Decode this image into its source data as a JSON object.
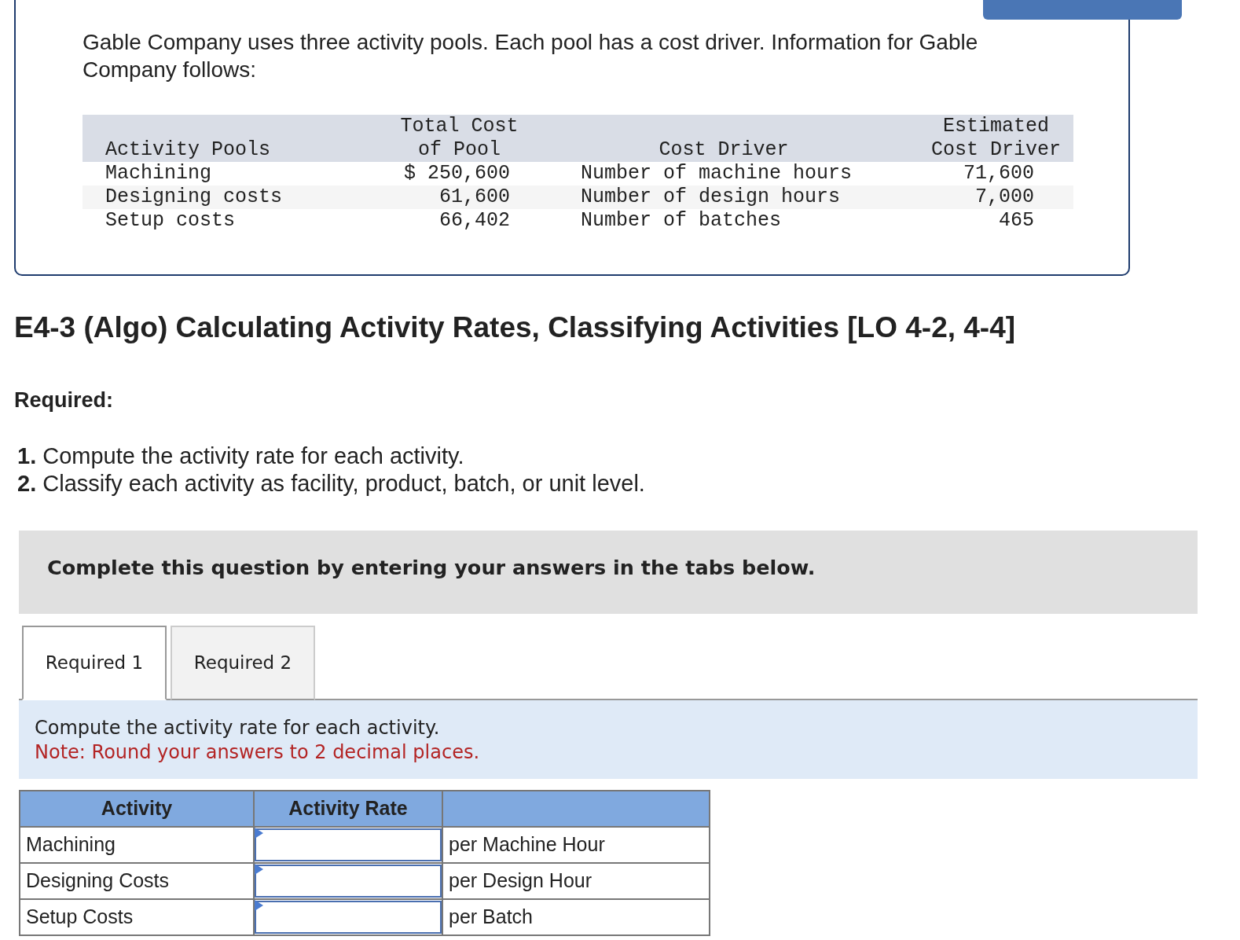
{
  "intro": "Gable Company uses three activity pools. Each pool has a cost driver. Information for Gable Company follows:",
  "pool_table": {
    "columns": [
      "Activity Pools",
      "Total Cost\nof Pool",
      "Cost Driver",
      "Estimated\nCost Driver"
    ],
    "rows": [
      [
        "Machining",
        "$ 250,600",
        "Number of machine hours",
        "71,600"
      ],
      [
        "Designing costs",
        "61,600",
        "Number of design hours",
        "7,000"
      ],
      [
        "Setup costs",
        "66,402",
        "Number of batches",
        "465"
      ]
    ]
  },
  "title": "E4-3 (Algo) Calculating Activity Rates, Classifying Activities [LO 4-2, 4-4]",
  "required_label": "Required:",
  "requirements": [
    {
      "number": "1.",
      "text": "Compute the activity rate for each activity."
    },
    {
      "number": "2.",
      "text": "Classify each activity as facility, product, batch, or unit level."
    }
  ],
  "instruction": "Complete this question by entering your answers in the tabs below.",
  "tabs": [
    {
      "label": "Required 1",
      "selected": true
    },
    {
      "label": "Required 2",
      "selected": false
    }
  ],
  "prompt": "Compute the activity rate for each activity.",
  "note": "Note: Round your answers to 2 decimal places.",
  "answer_table": {
    "columns": [
      "Activity",
      "Activity Rate"
    ],
    "rows": [
      {
        "activity": "Machining",
        "unit": "per Machine Hour"
      },
      {
        "activity": "Designing Costs",
        "unit": "per Design Hour"
      },
      {
        "activity": "Setup Costs",
        "unit": "per Batch"
      }
    ]
  }
}
